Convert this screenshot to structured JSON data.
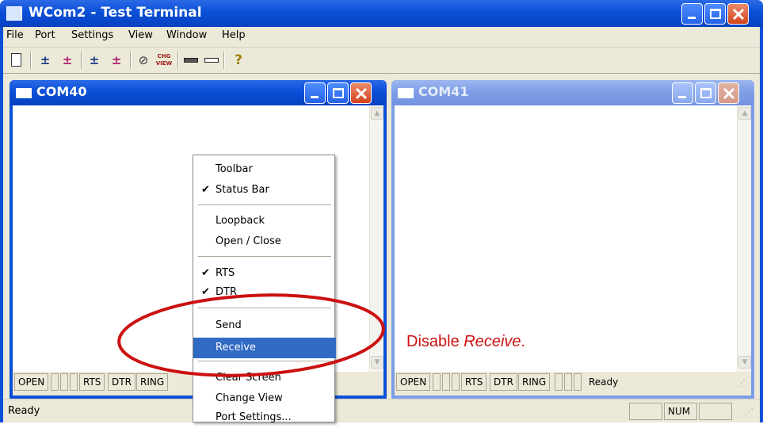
{
  "window": {
    "title": "WCom2 - Test Terminal"
  },
  "menu": [
    "File",
    "Port",
    "Settings",
    "View",
    "Window",
    "Help"
  ],
  "toolbar": {
    "icons": [
      "new-document-icon",
      "connect-icon",
      "disconnect-icon",
      "connect-all-icon",
      "disconnect-all-icon",
      "clear-icon",
      "change-view-icon",
      "send-bar-icon",
      "receive-bar-icon",
      "help-icon"
    ],
    "chg_view_text": "CHG VIEW"
  },
  "child_windows": [
    {
      "title": "COM40",
      "status": [
        "OPEN",
        "RTS",
        "DTR",
        "RING"
      ]
    },
    {
      "title": "COM41",
      "status": [
        "OPEN",
        "RTS",
        "DTR",
        "RING",
        "Ready"
      ]
    }
  ],
  "context_menu": {
    "items": [
      {
        "label": "Toolbar",
        "checked": false
      },
      {
        "label": "Status Bar",
        "checked": true
      },
      {
        "label": "Loopback",
        "checked": false
      },
      {
        "label": "Open / Close",
        "checked": false
      },
      {
        "label": "RTS",
        "checked": true
      },
      {
        "label": "DTR",
        "checked": true
      },
      {
        "label": "Send",
        "checked": false
      },
      {
        "label": "Receive",
        "checked": false,
        "highlighted": true
      },
      {
        "label": "Clear Screen",
        "checked": false
      },
      {
        "label": "Change View",
        "checked": false
      },
      {
        "label": "Port Settings...",
        "checked": false
      }
    ],
    "check_glyph": "✔"
  },
  "annotation": {
    "prefix": "Disable ",
    "emphasis": "Receive",
    "suffix": "."
  },
  "statusbar": {
    "text": "Ready",
    "num": "NUM"
  },
  "colors": {
    "highlight": "#316ac5",
    "annotation": "#cc1111",
    "xp_face": "#ece9d8"
  }
}
